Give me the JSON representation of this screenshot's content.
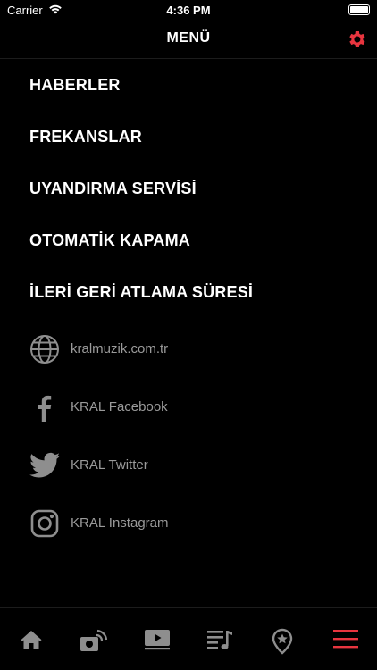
{
  "status_bar": {
    "carrier": "Carrier",
    "time": "4:36 PM"
  },
  "nav": {
    "title": "MENÜ"
  },
  "menu_items": [
    {
      "label": "HABERLER"
    },
    {
      "label": "FREKANSLAR"
    },
    {
      "label": "UYANDIRMA SERVİSİ"
    },
    {
      "label": "OTOMATİK KAPAMA"
    },
    {
      "label": "İLERİ GERİ ATLAMA SÜRESİ"
    }
  ],
  "links": [
    {
      "label": "kralmuzik.com.tr",
      "icon": "globe-icon"
    },
    {
      "label": "KRAL Facebook",
      "icon": "facebook-icon"
    },
    {
      "label": "KRAL Twitter",
      "icon": "twitter-icon"
    },
    {
      "label": "KRAL Instagram",
      "icon": "instagram-icon"
    }
  ],
  "tabs": [
    {
      "icon": "home-icon"
    },
    {
      "icon": "radio-icon"
    },
    {
      "icon": "video-icon"
    },
    {
      "icon": "playlist-icon"
    },
    {
      "icon": "location-star-icon"
    },
    {
      "icon": "menu-icon",
      "active": true
    }
  ],
  "colors": {
    "accent": "#e8353f",
    "background": "#000000",
    "text": "#ffffff",
    "muted": "#9a9a9a",
    "icon": "#8e8e8e"
  }
}
